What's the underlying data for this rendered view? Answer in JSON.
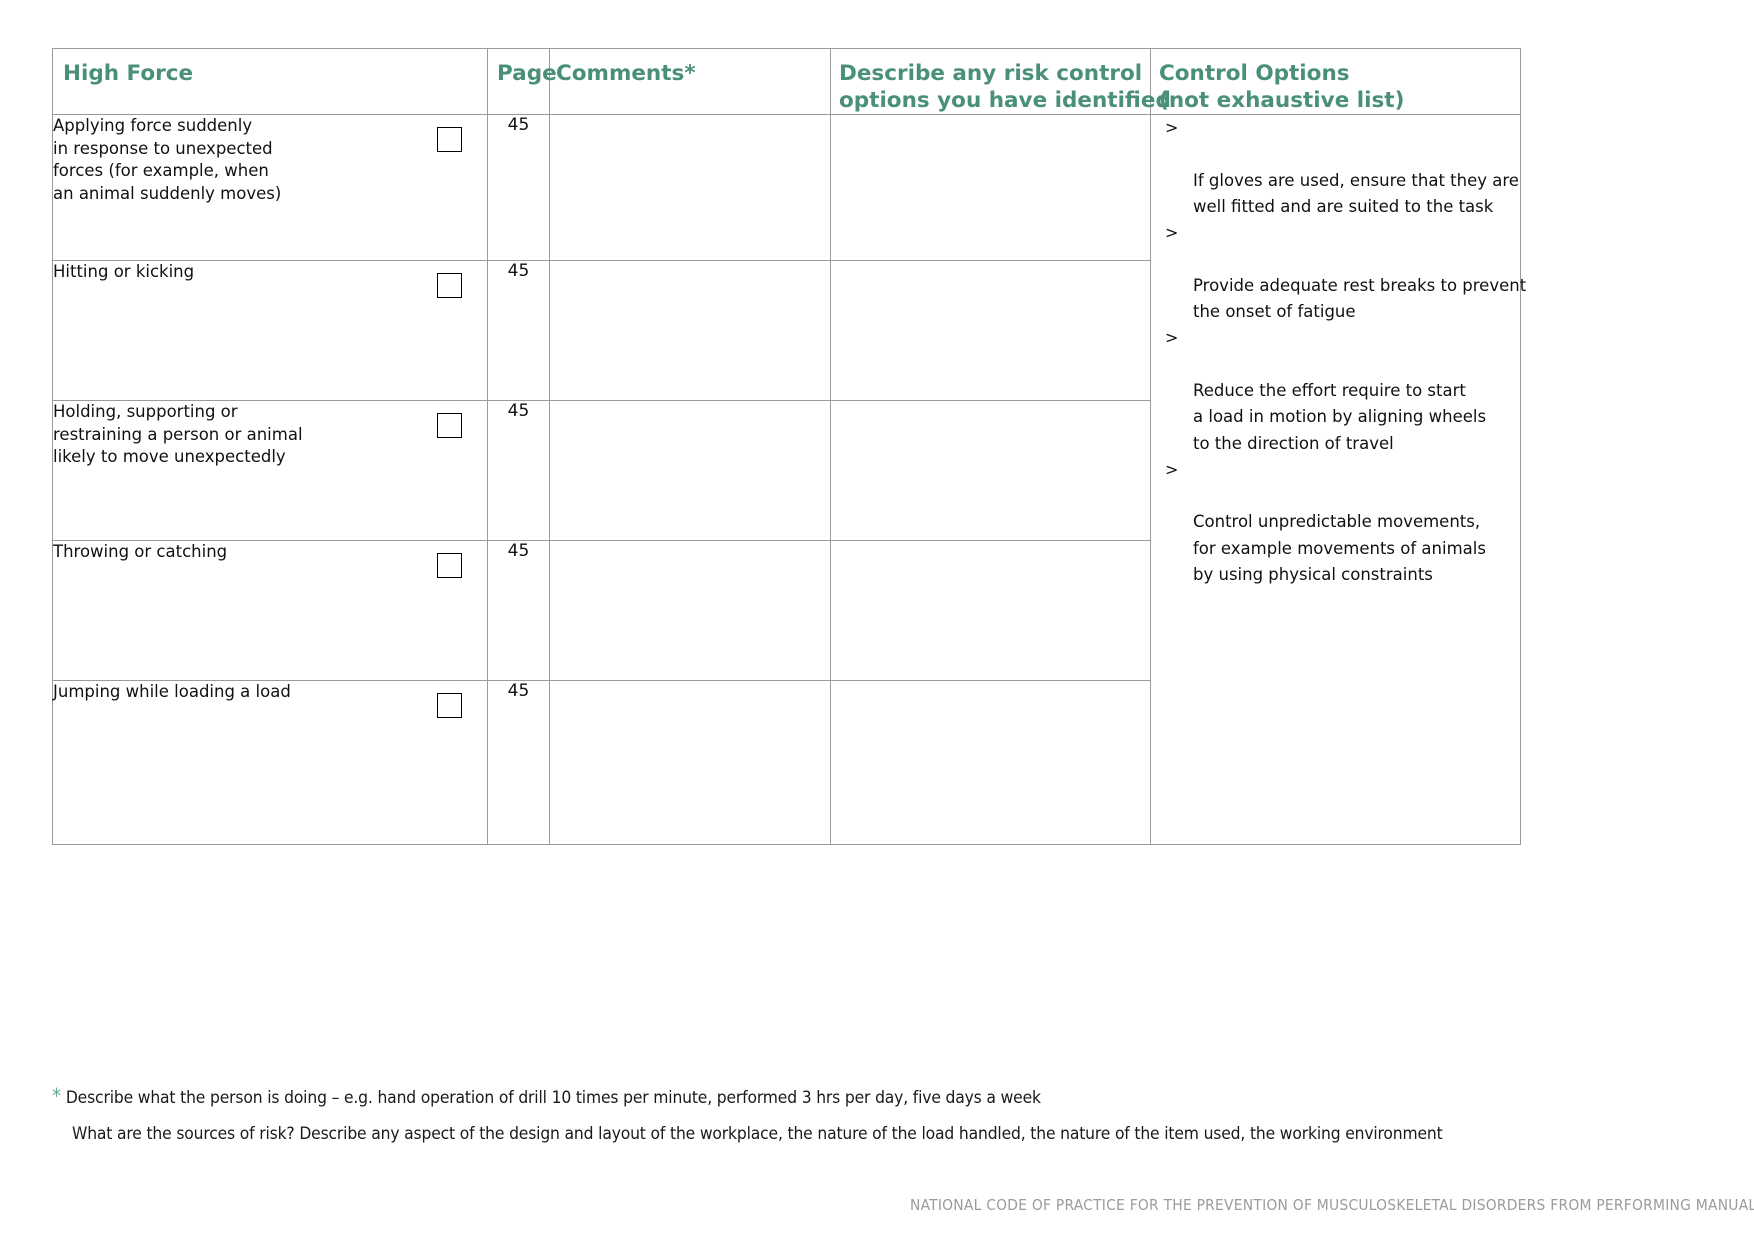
{
  "table": {
    "headers": {
      "hazard": "High Force",
      "page": "Page",
      "comments": "Comments*",
      "describe": "Describe any risk control\noptions you have identified",
      "control": "Control Options\n(not exhaustive list)"
    },
    "rows": [
      {
        "hazard": "Applying force suddenly\nin response to unexpected\nforces (for example, when\nan animal suddenly moves)",
        "page": "45",
        "comments": "",
        "describe": "",
        "checkbox_checked": false
      },
      {
        "hazard": "Hitting or kicking",
        "page": "45",
        "comments": "",
        "describe": "",
        "checkbox_checked": false
      },
      {
        "hazard": "Holding, supporting or\nrestraining a person or animal\nlikely to move unexpectedly",
        "page": "45",
        "comments": "",
        "describe": "",
        "checkbox_checked": false
      },
      {
        "hazard": "Throwing or catching",
        "page": "45",
        "comments": "",
        "describe": "",
        "checkbox_checked": false
      },
      {
        "hazard": "Jumping while loading a load",
        "page": "45",
        "comments": "",
        "describe": "",
        "checkbox_checked": false
      }
    ],
    "control_options": {
      "marker": ">",
      "items": [
        "If gloves are used, ensure that they are\nwell fitted and are suited to the task",
        "Provide adequate rest breaks to prevent\nthe onset of fatigue",
        "Reduce the effort require to start\na load in motion by aligning wheels\nto the direction of travel",
        "Control unpredictable movements,\nfor example movements of animals\nby using physical constraints"
      ]
    }
  },
  "footnote": {
    "star": "*",
    "line1": "Describe what the person is doing – e.g. hand operation of drill 10 times per minute, performed 3 hrs per day, five days a week",
    "line2": "What are the sources of risk? Describe any aspect of the design and layout of the workplace, the nature of the load handled, the nature of the item used, the working environment"
  },
  "page_footer": {
    "text": "NATIONAL CODE OF PRACTICE FOR THE PREVENTION OF MUSCULOSKELETAL DISORDERS FROM PERFORMING MANUAL TASKS AT WORK"
  },
  "colors": {
    "header_bg": "#e3ebe5",
    "header_text": "#4a9077",
    "accent": "#63a98c",
    "border": "#9a9a9a",
    "footer_text": "#9b9b9b"
  }
}
